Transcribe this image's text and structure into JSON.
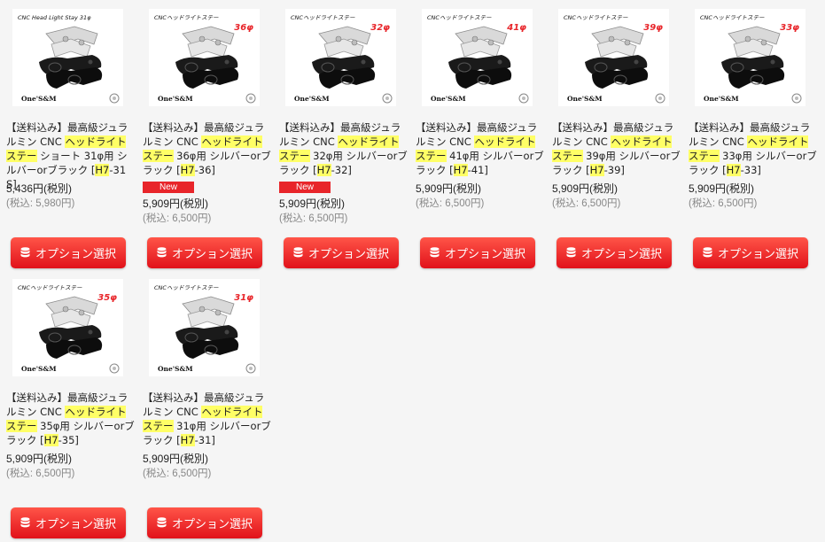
{
  "products": [
    {
      "title_pre": "【送料込み】最高級ジュラルミン CNC ",
      "title_hl": "ヘッドライトステー",
      "title_post": " ショート 31φ用 シルバーorブラック [",
      "code_hl": "H7",
      "code_post": "-31S]",
      "new_badge": "",
      "price": "5,436円(税別)",
      "price_tax": "(税込: 5,980円)",
      "thumb_banner": "CNC Head Light Stay 31φ",
      "thumb_size": "",
      "thumb_logo": "One'S&M",
      "button_label": "オプション選択"
    },
    {
      "title_pre": "【送料込み】最高級ジュラルミン CNC ",
      "title_hl": "ヘッドライトステー",
      "title_post": " 36φ用 シルバーorブラック [",
      "code_hl": "H7",
      "code_post": "-36]",
      "new_badge": "New",
      "price": "5,909円(税別)",
      "price_tax": "(税込: 6,500円)",
      "thumb_banner": "CNCヘッドライトステー",
      "thumb_size": "36φ",
      "thumb_logo": "One'S&M",
      "button_label": "オプション選択"
    },
    {
      "title_pre": "【送料込み】最高級ジュラルミン CNC ",
      "title_hl": "ヘッドライトステー",
      "title_post": " 32φ用 シルバーorブラック [",
      "code_hl": "H7",
      "code_post": "-32]",
      "new_badge": "New",
      "price": "5,909円(税別)",
      "price_tax": "(税込: 6,500円)",
      "thumb_banner": "CNCヘッドライトステー",
      "thumb_size": "32φ",
      "thumb_logo": "One'S&M",
      "button_label": "オプション選択"
    },
    {
      "title_pre": "【送料込み】最高級ジュラルミン CNC ",
      "title_hl": "ヘッドライトステー",
      "title_post": " 41φ用 シルバーorブラック [",
      "code_hl": "H7",
      "code_post": "-41]",
      "new_badge": "",
      "price": "5,909円(税別)",
      "price_tax": "(税込: 6,500円)",
      "thumb_banner": "CNCヘッドライトステー",
      "thumb_size": "41φ",
      "thumb_logo": "One'S&M",
      "button_label": "オプション選択"
    },
    {
      "title_pre": "【送料込み】最高級ジュラルミン CNC ",
      "title_hl": "ヘッドライトステー",
      "title_post": " 39φ用 シルバーorブラック [",
      "code_hl": "H7",
      "code_post": "-39]",
      "new_badge": "",
      "price": "5,909円(税別)",
      "price_tax": "(税込: 6,500円)",
      "thumb_banner": "CNCヘッドライトステー",
      "thumb_size": "39φ",
      "thumb_logo": "One'S&M",
      "button_label": "オプション選択"
    },
    {
      "title_pre": "【送料込み】最高級ジュラルミン CNC ",
      "title_hl": "ヘッドライトステー",
      "title_post": " 33φ用 シルバーorブラック [",
      "code_hl": "H7",
      "code_post": "-33]",
      "new_badge": "",
      "price": "5,909円(税別)",
      "price_tax": "(税込: 6,500円)",
      "thumb_banner": "CNCヘッドライトステー",
      "thumb_size": "33φ",
      "thumb_logo": "One'S&M",
      "button_label": "オプション選択"
    },
    {
      "title_pre": "【送料込み】最高級ジュラルミン CNC ",
      "title_hl": "ヘッドライトステー",
      "title_post": " 35φ用 シルバーorブラック [",
      "code_hl": "H7",
      "code_post": "-35]",
      "new_badge": "",
      "price": "5,909円(税別)",
      "price_tax": "(税込: 6,500円)",
      "thumb_banner": "CNCヘッドライトステー",
      "thumb_size": "35φ",
      "thumb_logo": "One'S&M",
      "button_label": "オプション選択"
    },
    {
      "title_pre": "【送料込み】最高級ジュラルミン CNC ",
      "title_hl": "ヘッドライトステー",
      "title_post": " 31φ用 シルバーorブラック [",
      "code_hl": "H7",
      "code_post": "-31]",
      "new_badge": "",
      "price": "5,909円(税別)",
      "price_tax": "(税込: 6,500円)",
      "thumb_banner": "CNCヘッドライトステー",
      "thumb_size": "31φ",
      "thumb_logo": "One'S&M",
      "button_label": "オプション選択"
    }
  ],
  "colors": {
    "button_top": "#ff5548",
    "button_bottom": "#e1111a",
    "highlight": "#ffff66",
    "new_badge": "#e8252a",
    "size_tag": "#e8252a"
  },
  "icons": {
    "button_icon": "database-icon",
    "thumb_image": "headlight-stay-product-photo"
  }
}
